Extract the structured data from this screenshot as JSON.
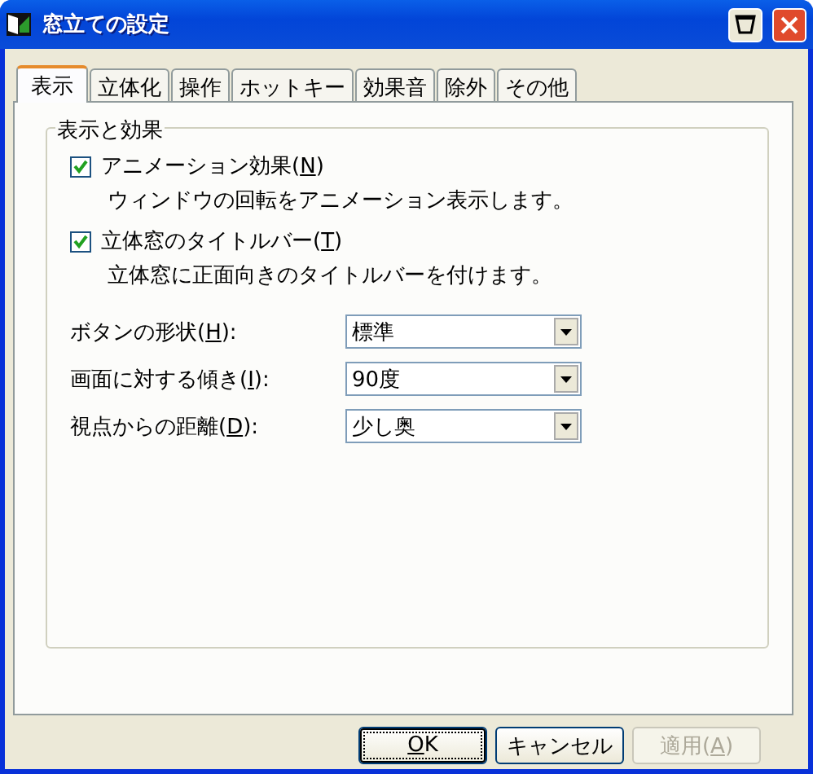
{
  "window": {
    "title": "窓立ての設定"
  },
  "tabs": [
    {
      "label": "表示",
      "selected": true
    },
    {
      "label": "立体化",
      "selected": false
    },
    {
      "label": "操作",
      "selected": false
    },
    {
      "label": "ホットキー",
      "selected": false
    },
    {
      "label": "効果音",
      "selected": false
    },
    {
      "label": "除外",
      "selected": false
    },
    {
      "label": "その他",
      "selected": false
    }
  ],
  "group": {
    "title": "表示と効果",
    "options": [
      {
        "before": "アニメーション効果(",
        "key": "N",
        "after": ")",
        "checked": true,
        "description": "ウィンドウの回転をアニメーション表示します。"
      },
      {
        "before": "立体窓のタイトルバー(",
        "key": "T",
        "after": ")",
        "checked": true,
        "description": "立体窓に正面向きのタイトルバーを付けます。"
      }
    ],
    "fields": [
      {
        "before": "ボタンの形状(",
        "key": "H",
        "after": "):",
        "value": "標準"
      },
      {
        "before": "画面に対する傾き(",
        "key": "I",
        "after": "):",
        "value": "90度"
      },
      {
        "before": "視点からの距離(",
        "key": "D",
        "after": "):",
        "value": "少し奥"
      }
    ]
  },
  "buttons": [
    {
      "key": "O",
      "after": "K",
      "default": true,
      "disabled": false
    },
    {
      "before": "キャンセル",
      "default": false,
      "disabled": false
    },
    {
      "before": "適用(",
      "key": "A",
      "after": ")",
      "default": false,
      "disabled": true
    }
  ]
}
